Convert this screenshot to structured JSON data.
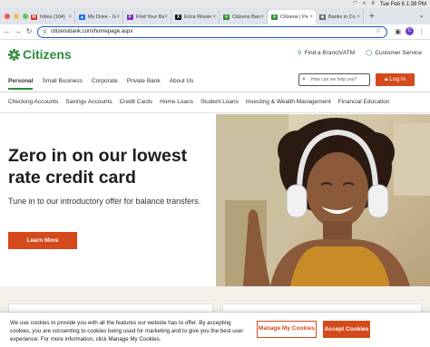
{
  "menubar": {
    "datetime": "Tue Feb 6  1:39 PM"
  },
  "tabs": [
    {
      "label": "Inbox (104)",
      "favicon": "gmail-icon",
      "color": "#d93025",
      "glyph": "M"
    },
    {
      "label": "My Drive - G",
      "favicon": "drive-icon",
      "color": "#1a73e8",
      "glyph": "▲"
    },
    {
      "label": "Find Your Bu",
      "favicon": "find-icon",
      "color": "#7b2cbf",
      "glyph": "F"
    },
    {
      "label": "Erica Wissin",
      "favicon": "x-icon",
      "color": "#111111",
      "glyph": "X"
    },
    {
      "label": "Citizens Ban",
      "favicon": "citizens-icon",
      "color": "#2e8b3a",
      "glyph": "✲"
    },
    {
      "label": "Citizens | Pe",
      "favicon": "citizens-icon",
      "color": "#2e8b3a",
      "glyph": "✲",
      "active": true
    },
    {
      "label": "Banks in Co",
      "favicon": "generic-icon",
      "color": "#5f6368",
      "glyph": "◉"
    }
  ],
  "address": {
    "url": "citizensbank.com/homepage.aspx"
  },
  "avatar_letter": "C",
  "brand": {
    "name": "Citizens",
    "color": "#2e8b3a",
    "accent": "#d54a1c"
  },
  "utility": {
    "branch": "Find a Branch/ATM",
    "service": "Customer Service"
  },
  "mainnav": [
    "Personal",
    "Small Business",
    "Corporate",
    "Private Bank",
    "About Us"
  ],
  "search": {
    "placeholder": "How can we help you?"
  },
  "login": {
    "label": "Log in"
  },
  "subnav": [
    "Checking Accounts",
    "Savings Accounts",
    "Credit Cards",
    "Home Loans",
    "Student Loans",
    "Investing & Wealth Management",
    "Financial Education"
  ],
  "hero": {
    "headline": "Zero in on our lowest rate credit card",
    "subhead": "Tune in to our introductory offer for balance transfers.",
    "cta": "Learn More"
  },
  "cookie": {
    "text": "We use cookies to provide you with all the features our website has to offer. By accepting cookies, you are consenting to cookies being used for marketing and to give you the best user experience. For more information, click Manage My Cookies.",
    "manage": "Manage My Cookies",
    "accept": "Accept Cookies"
  }
}
